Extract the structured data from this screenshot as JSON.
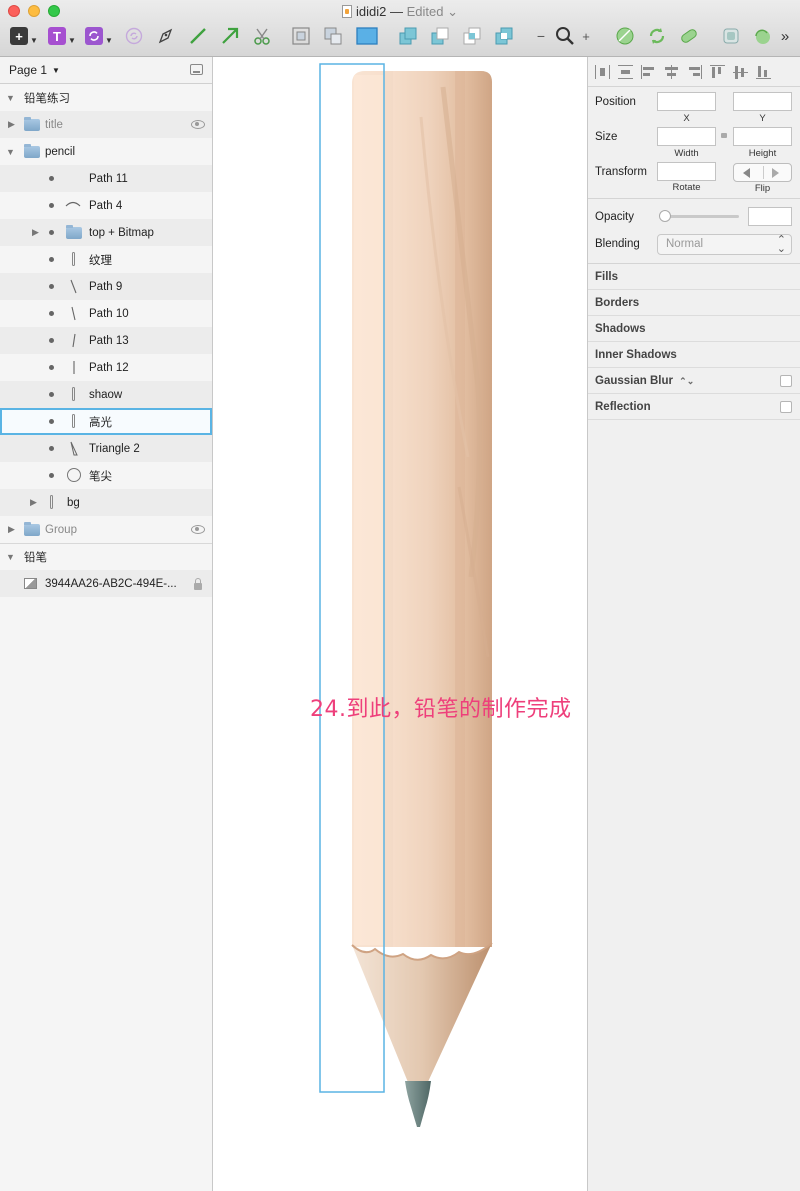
{
  "window": {
    "title": "ididi2",
    "separator": "—",
    "status": "Edited",
    "chevron": "⌄"
  },
  "toolbar": {
    "insert_glyph": "+",
    "text_glyph": "T",
    "zoom_minus": "−",
    "zoom_plus": "+",
    "more": "»"
  },
  "layers": {
    "page_selector": "Page 1",
    "groups": [
      {
        "label": "铅笔练习"
      }
    ],
    "items": [
      {
        "label": "title"
      },
      {
        "label": "pencil"
      },
      {
        "label": "Path 11"
      },
      {
        "label": "Path 4"
      },
      {
        "label": "top + Bitmap"
      },
      {
        "label": "纹理"
      },
      {
        "label": "Path 9"
      },
      {
        "label": "Path 10"
      },
      {
        "label": "Path 13"
      },
      {
        "label": "Path 12"
      },
      {
        "label": "shaow"
      },
      {
        "label": "高光"
      },
      {
        "label": "Triangle 2"
      },
      {
        "label": "笔尖"
      },
      {
        "label": "bg"
      },
      {
        "label": "Group"
      }
    ],
    "page2": {
      "label": "铅笔"
    },
    "slice": {
      "label": "3944AA26-AB2C-494E-..."
    }
  },
  "canvas": {
    "caption": "24.到此，铅笔的制作完成"
  },
  "inspector": {
    "position_label": "Position",
    "x_label": "X",
    "y_label": "Y",
    "size_label": "Size",
    "width_label": "Width",
    "height_label": "Height",
    "transform_label": "Transform",
    "rotate_label": "Rotate",
    "flip_label": "Flip",
    "opacity_label": "Opacity",
    "blending_label": "Blending",
    "blending_value": "Normal",
    "sections": {
      "fills": "Fills",
      "borders": "Borders",
      "shadows": "Shadows",
      "inner_shadows": "Inner Shadows",
      "gaussian_blur": "Gaussian Blur",
      "reflection": "Reflection"
    },
    "gaussian_chevron": "⌃⌄"
  },
  "colors": {
    "selection": "#5ab4e4",
    "caption": "#ee3f7b",
    "pencil_wood": "#f0d5c0",
    "pencil_lead": "#5f7a78"
  },
  "icons": [
    "insert-icon",
    "text-icon",
    "symbol-icon",
    "vector-icon",
    "pen-icon",
    "line-icon",
    "arrow-icon",
    "scissors-icon",
    "group-icon",
    "ungroup-icon",
    "artboard-icon",
    "union-icon",
    "subtract-icon",
    "intersect-icon",
    "difference-icon",
    "zoom-icon",
    "eye-icon",
    "lock-icon",
    "folder-icon"
  ]
}
